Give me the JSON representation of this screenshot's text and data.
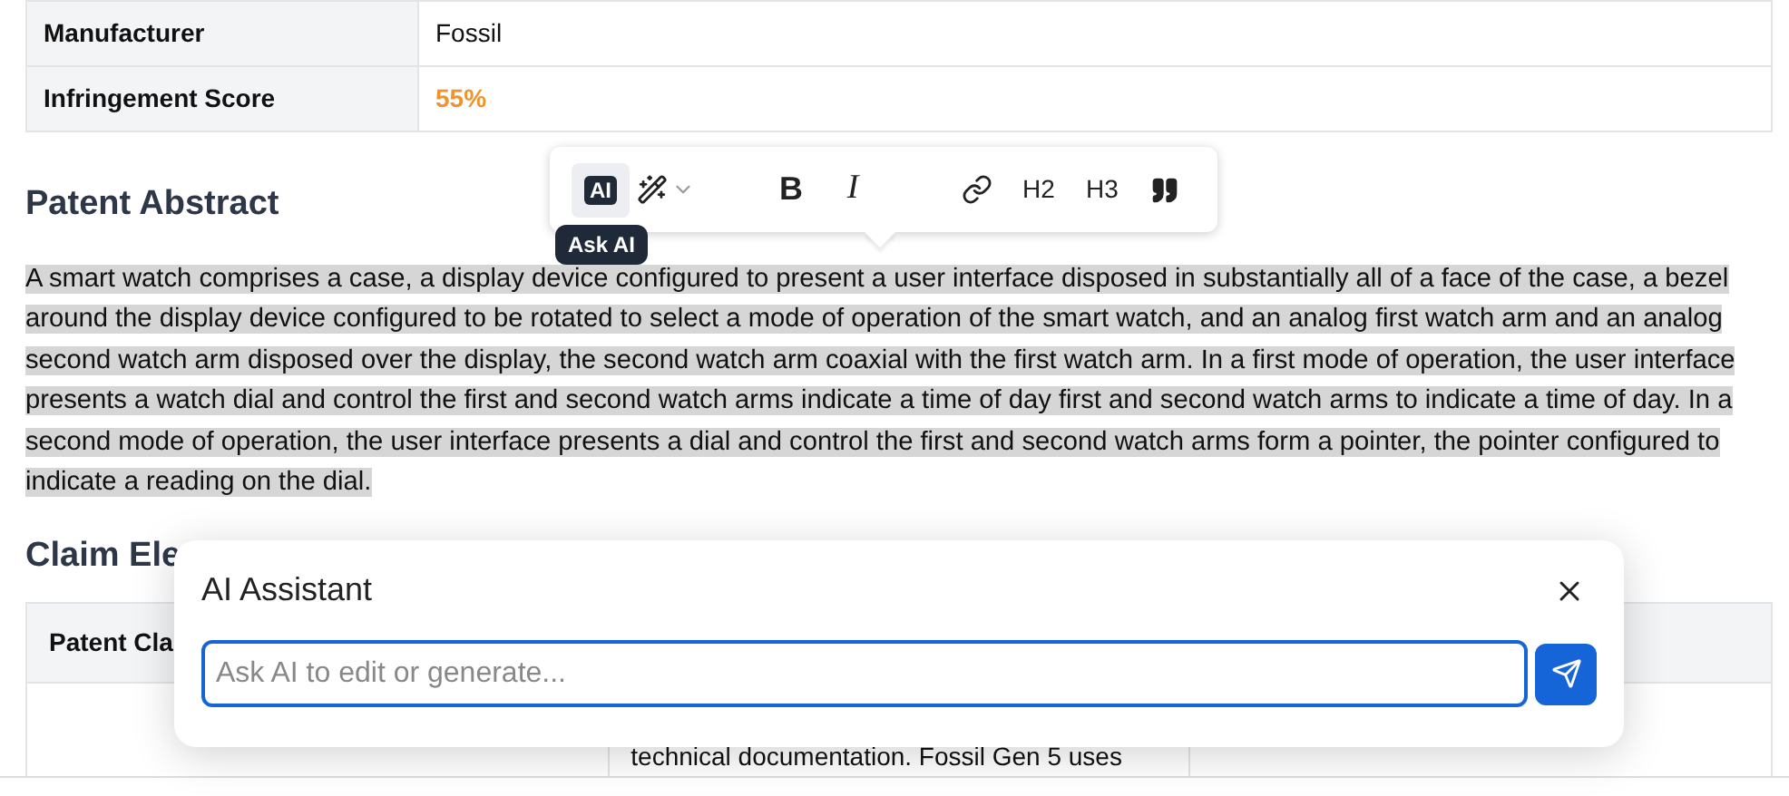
{
  "details_table": {
    "rows": [
      {
        "label": "Manufacturer",
        "value": "Fossil",
        "kind": "plain"
      },
      {
        "label": "Infringement Score",
        "value": "55%",
        "kind": "score"
      }
    ]
  },
  "abstract": {
    "heading": "Patent Abstract",
    "text": "A smart watch comprises a case, a display device configured to present a user interface disposed in substantially all of a face of the case, a bezel around the display device configured to be rotated to select a mode of operation of the smart watch, and an analog first watch arm and an analog second watch arm disposed over the display, the second watch arm coaxial with the first watch arm. In a first mode of operation, the user interface presents a watch dial and control the first and second watch arms indicate a time of day first and second watch arms to indicate a time of day. In a second mode of operation, the user interface presents a dial and control the first and second watch arms form a pointer, the pointer configured to indicate a reading on the dial.",
    "selected": true
  },
  "claims": {
    "heading": "Claim Ele",
    "table": {
      "columns": [
        "Patent Cla"
      ],
      "rows": [
        {
          "cells": [
            "",
            "technical documentation. Fossil Gen 5 uses",
            ""
          ]
        }
      ]
    }
  },
  "toolbar": {
    "buttons": [
      {
        "kind": "ai",
        "label": "AI",
        "selected": true
      },
      {
        "kind": "wand"
      },
      {
        "kind": "bold",
        "label": "B"
      },
      {
        "kind": "italic",
        "label": "I"
      },
      {
        "kind": "link"
      },
      {
        "kind": "text",
        "label": "H2"
      },
      {
        "kind": "text",
        "label": "H3"
      },
      {
        "kind": "quote"
      }
    ],
    "tooltip": "Ask AI"
  },
  "dialog": {
    "title": "AI Assistant",
    "placeholder": "Ask AI to edit or generate..."
  }
}
